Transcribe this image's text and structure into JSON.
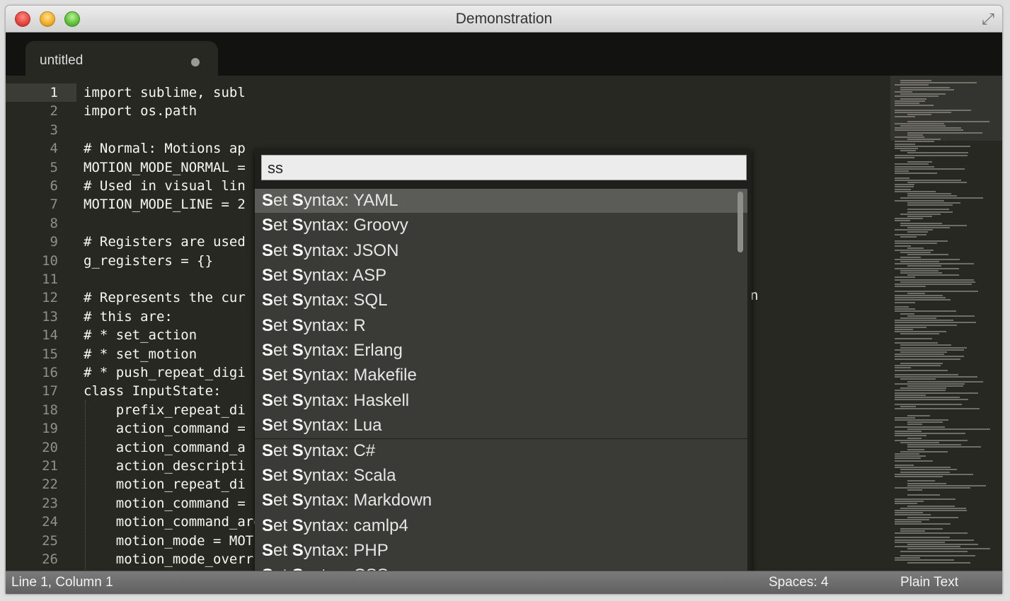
{
  "window": {
    "title": "Demonstration"
  },
  "tab": {
    "label": "untitled"
  },
  "editor": {
    "line_numbers": [
      "1",
      "2",
      "3",
      "4",
      "5",
      "6",
      "7",
      "8",
      "9",
      "10",
      "11",
      "12",
      "13",
      "14",
      "15",
      "16",
      "17",
      "18",
      "19",
      "20",
      "21",
      "22",
      "23",
      "24",
      "25",
      "26"
    ],
    "code_lines": [
      "import sublime, subl",
      "import os.path",
      "",
      "# Normal: Motions ap",
      "MOTION_MODE_NORMAL =",
      "# Used in visual lin",
      "MOTION_MODE_LINE = 2",
      "",
      "# Registers are used",
      "g_registers = {}",
      "",
      "# Represents the cur",
      "# this are:",
      "# * set_action",
      "# * set_motion",
      "# * push_repeat_digi",
      "class InputState:",
      "    prefix_repeat_di",
      "    action_command =",
      "    action_command_a",
      "    action_descripti",
      "    motion_repeat_di",
      "    motion_command =",
      "    motion_command_args = None",
      "    motion_mode = MOTION_MODE_NORMAL",
      "    motion_mode_overridden = False"
    ],
    "edge_char": "n"
  },
  "command_palette": {
    "query": "ss",
    "items": [
      {
        "prefix": "Set Syntax: ",
        "name": "YAML"
      },
      {
        "prefix": "Set Syntax: ",
        "name": "Groovy"
      },
      {
        "prefix": "Set Syntax: ",
        "name": "JSON"
      },
      {
        "prefix": "Set Syntax: ",
        "name": "ASP"
      },
      {
        "prefix": "Set Syntax: ",
        "name": "SQL"
      },
      {
        "prefix": "Set Syntax: ",
        "name": "R"
      },
      {
        "prefix": "Set Syntax: ",
        "name": "Erlang"
      },
      {
        "prefix": "Set Syntax: ",
        "name": "Makefile"
      },
      {
        "prefix": "Set Syntax: ",
        "name": "Haskell"
      },
      {
        "prefix": "Set Syntax: ",
        "name": "Lua"
      },
      {
        "prefix": "Set Syntax: ",
        "name": "C#"
      },
      {
        "prefix": "Set Syntax: ",
        "name": "Scala"
      },
      {
        "prefix": "Set Syntax: ",
        "name": "Markdown"
      },
      {
        "prefix": "Set Syntax: ",
        "name": "camlp4"
      },
      {
        "prefix": "Set Syntax: ",
        "name": "PHP"
      },
      {
        "prefix": "Set Syntax: ",
        "name": "CSS"
      }
    ]
  },
  "statusbar": {
    "position": "Line 1, Column 1",
    "spaces": "Spaces: 4",
    "syntax": "Plain Text"
  },
  "icons": {
    "close": "close-icon",
    "minimize": "minimize-icon",
    "maximize": "maximize-icon",
    "fullscreen": "fullscreen-icon",
    "dirty": "unsaved-dot-icon"
  }
}
